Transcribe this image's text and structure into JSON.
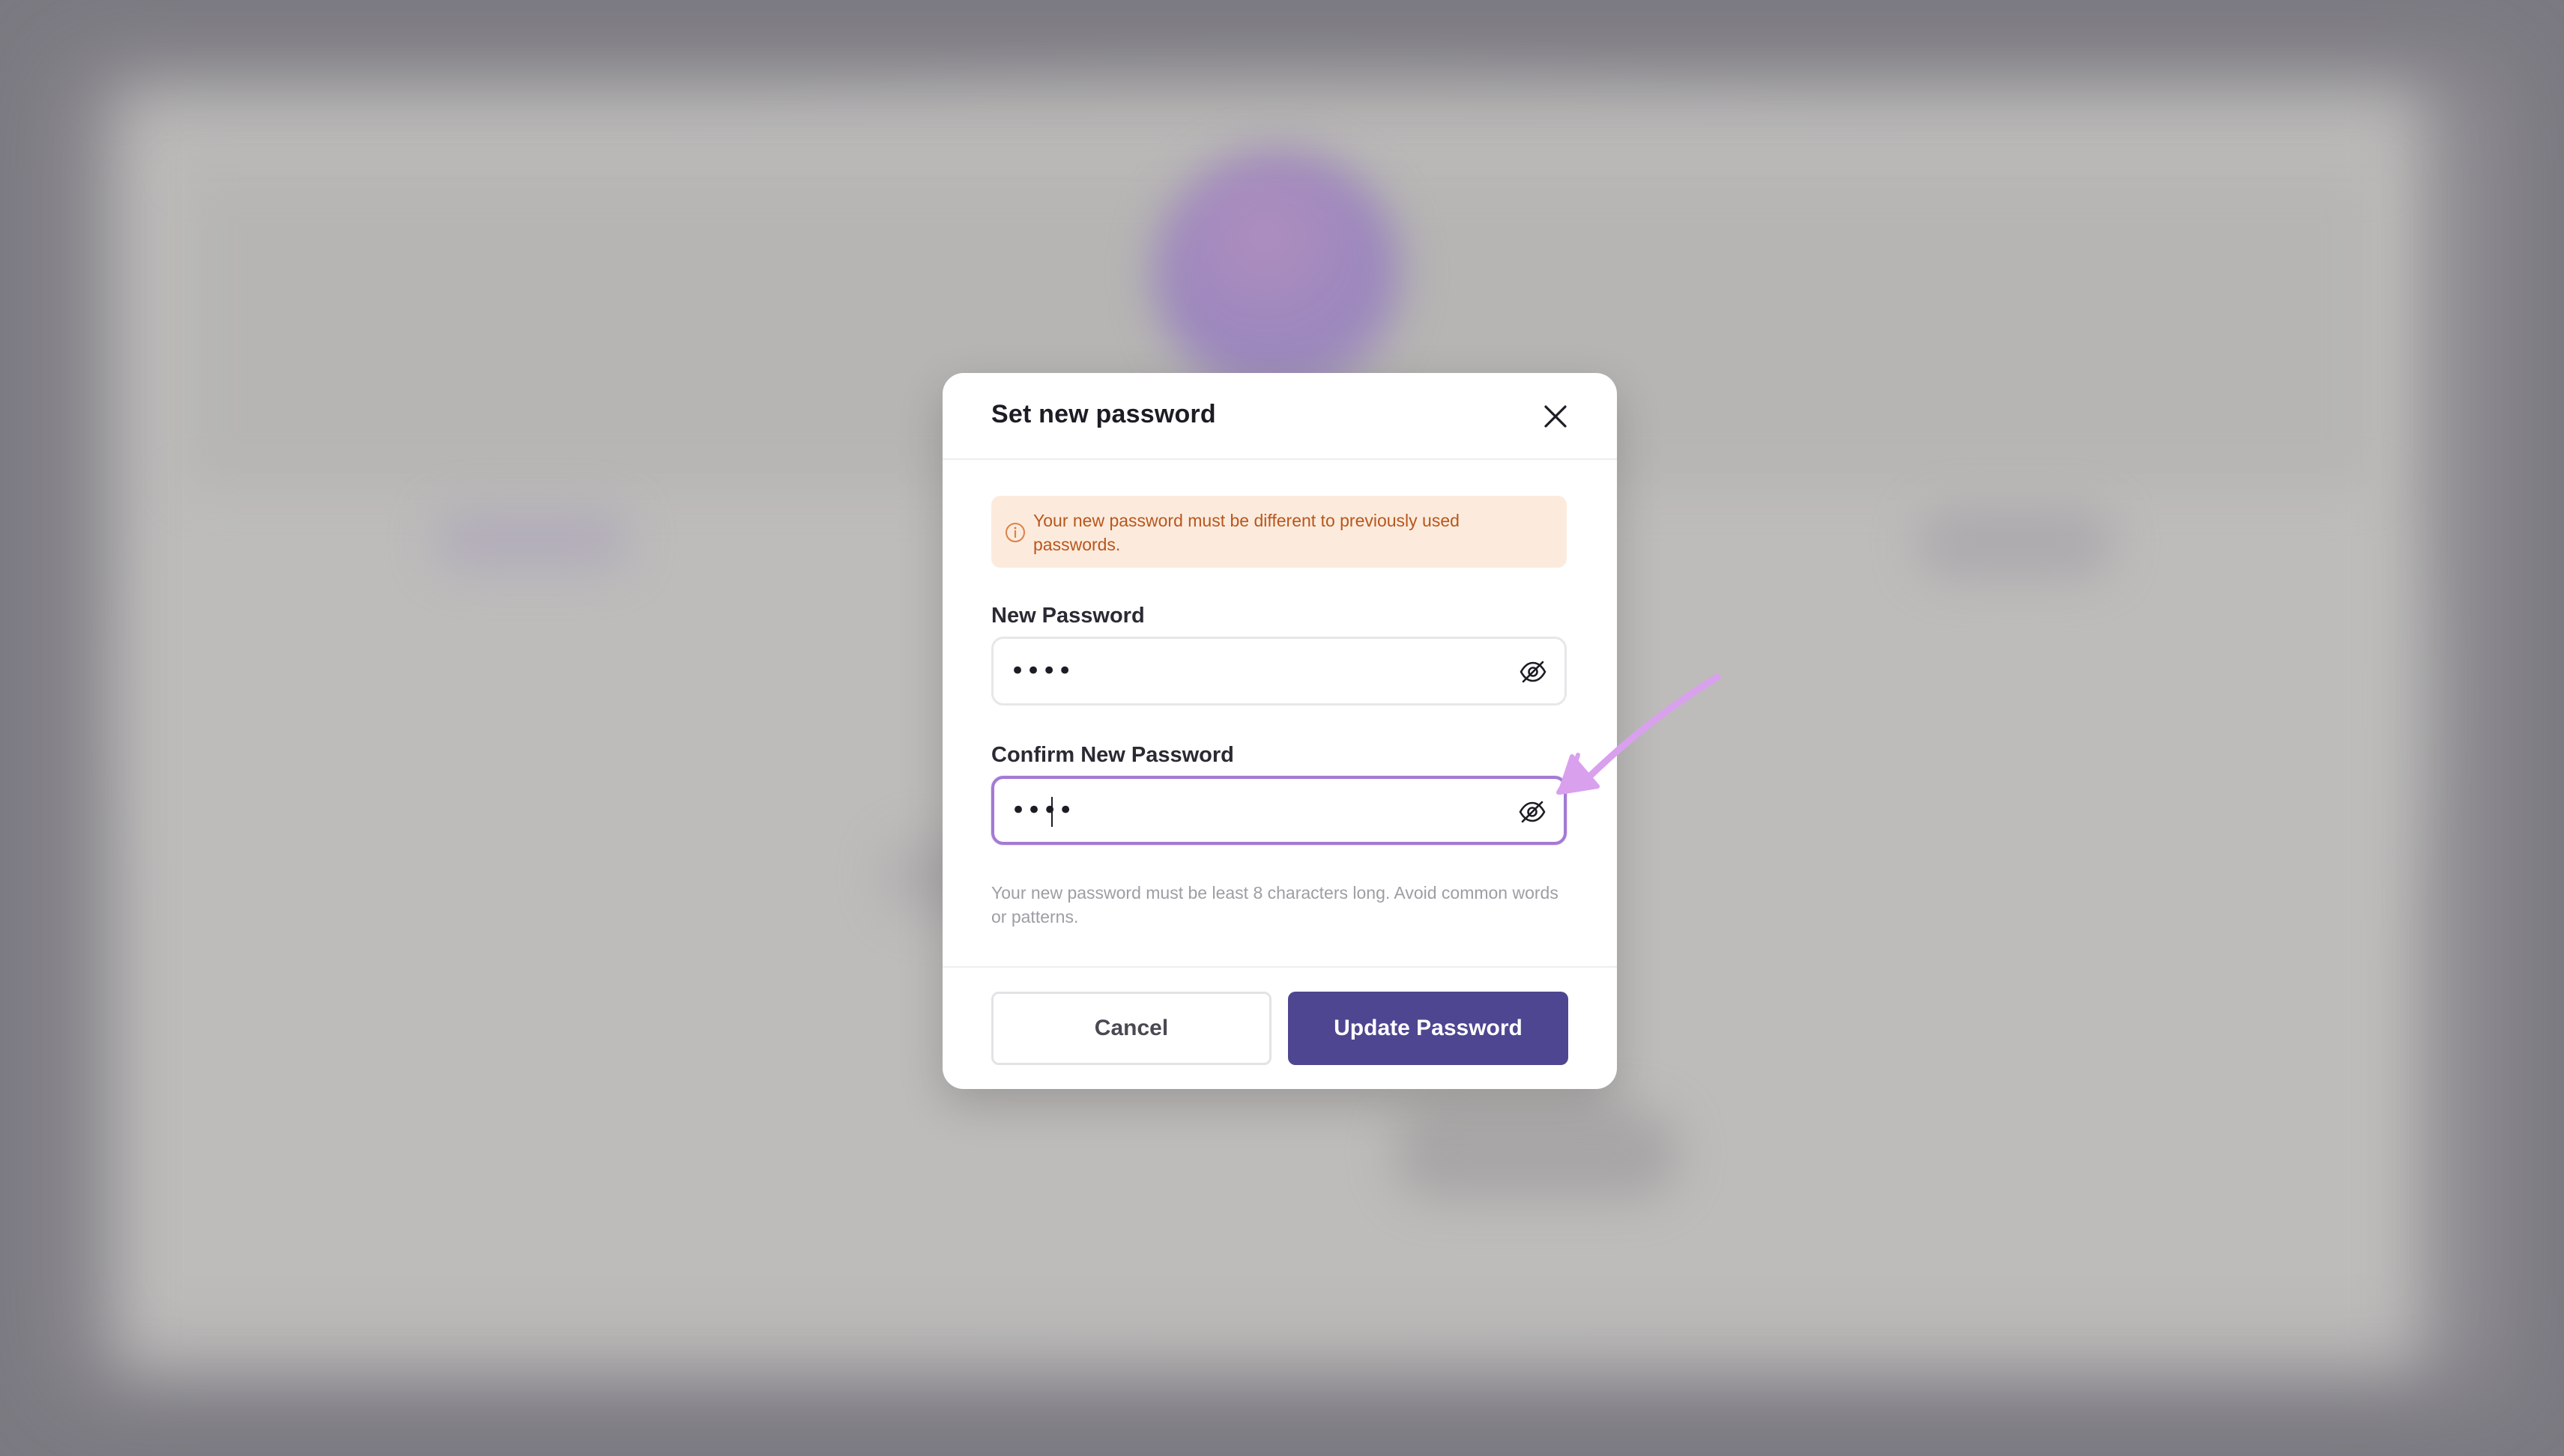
{
  "dialog": {
    "title": "Set new password",
    "alert": {
      "text": "Your new password must be different to previously used passwords.",
      "icon": "info-circle-icon",
      "color": "#b8561c",
      "background": "#fcebdd"
    },
    "new_password": {
      "label": "New Password",
      "value": "••••",
      "toggle_icon": "eye-off-icon"
    },
    "confirm_password": {
      "label": "Confirm New Password",
      "value": "••••",
      "toggle_icon": "eye-off-icon",
      "focused": true
    },
    "hint": "Your new password must be least 8 characters long. Avoid common words or patterns.",
    "buttons": {
      "cancel": "Cancel",
      "update": "Update Password"
    }
  },
  "colors": {
    "accent": "#4e4690",
    "focus_ring": "#a47ad4",
    "annotation": "#d9a0ee"
  }
}
